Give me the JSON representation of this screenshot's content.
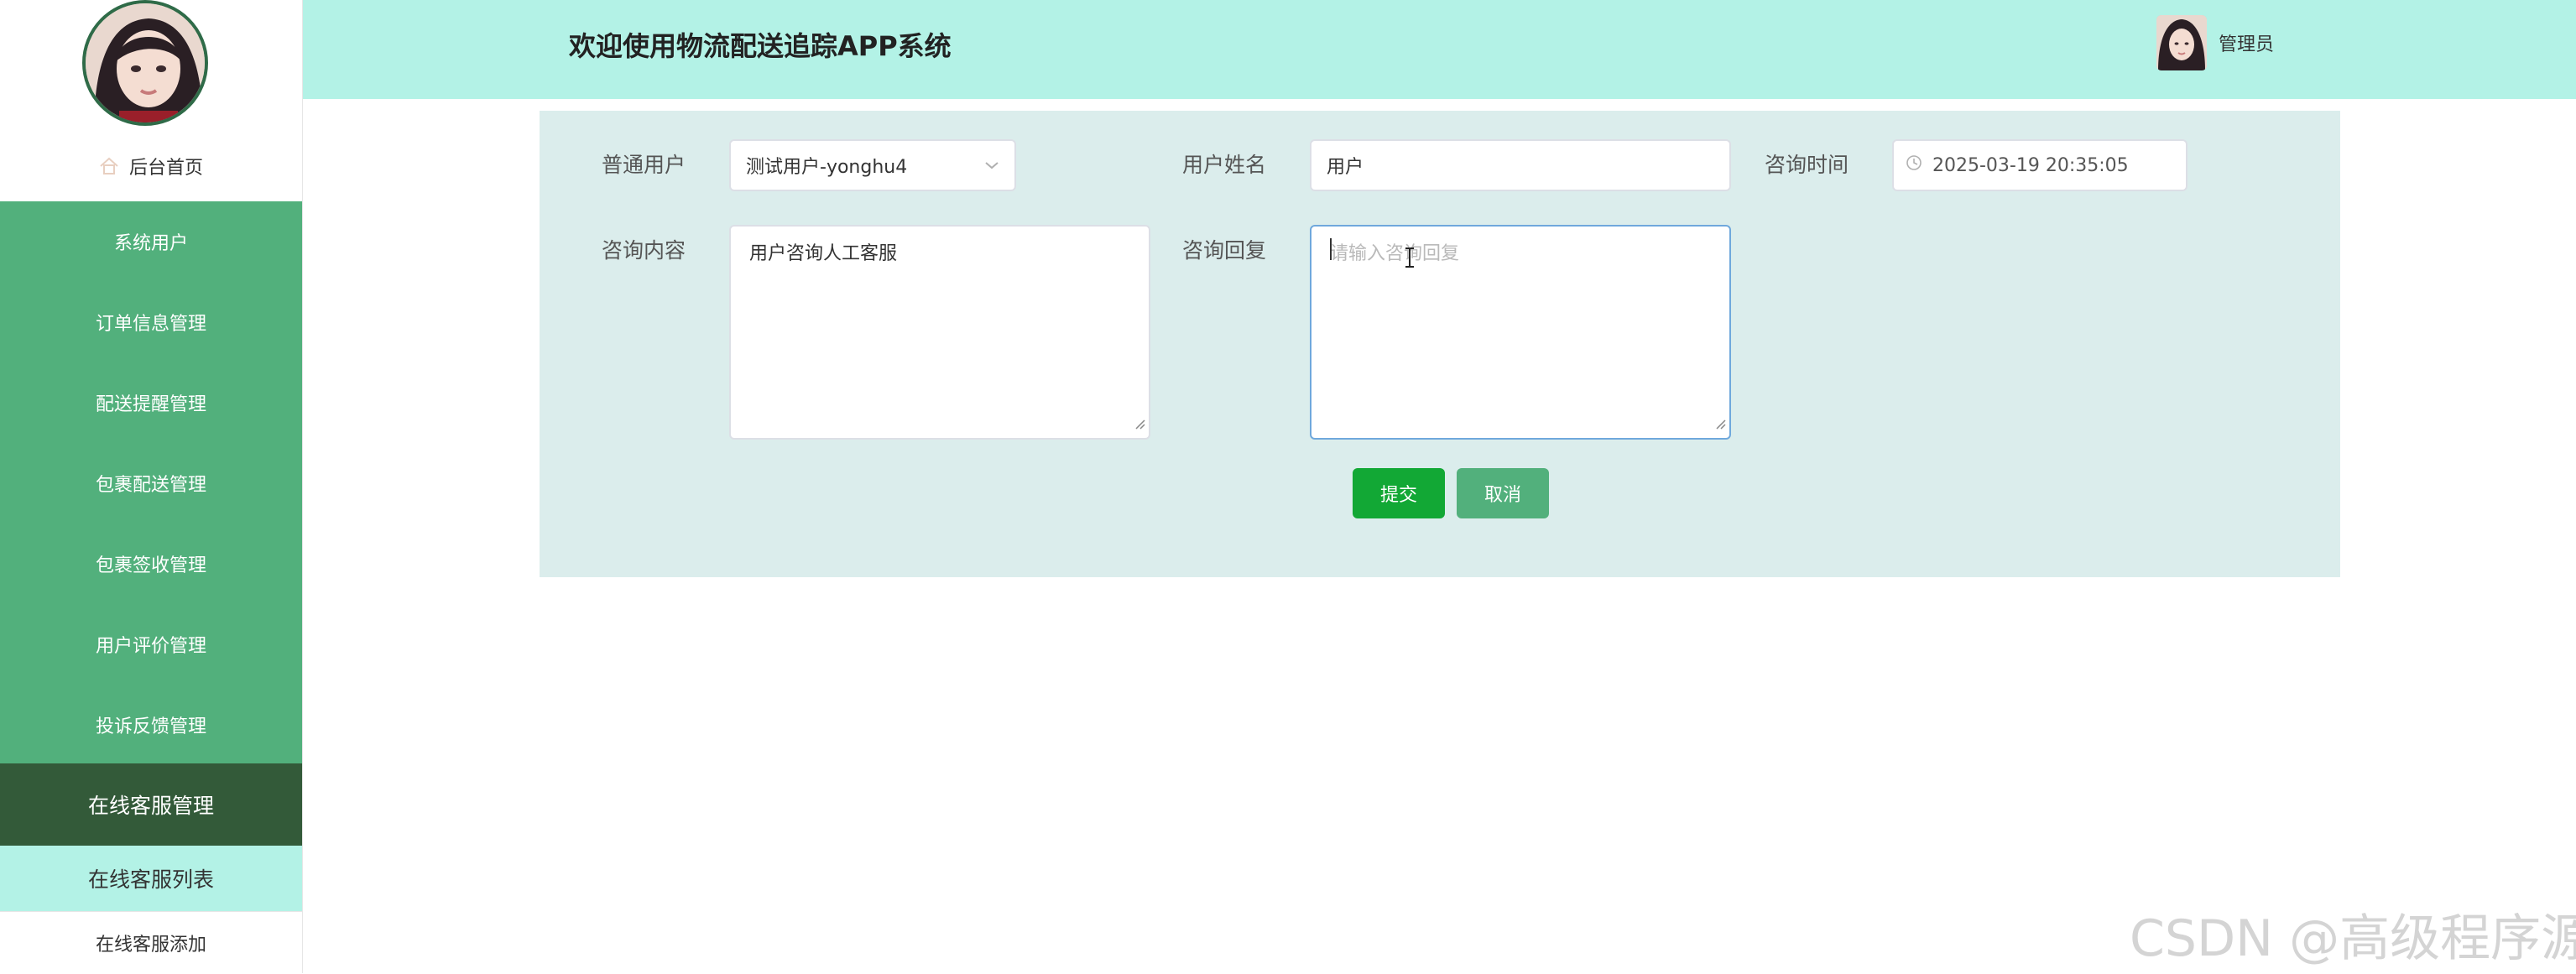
{
  "header": {
    "title": "欢迎使用物流配送追踪APP系统",
    "user_name": "管理员"
  },
  "sidebar": {
    "home_label": "后台首页",
    "menu": [
      {
        "label": "系统用户"
      },
      {
        "label": "订单信息管理"
      },
      {
        "label": "配送提醒管理"
      },
      {
        "label": "包裹配送管理"
      },
      {
        "label": "包裹签收管理"
      },
      {
        "label": "用户评价管理"
      },
      {
        "label": "投诉反馈管理"
      }
    ],
    "active_menu": {
      "label": "在线客服管理"
    },
    "submenu": [
      {
        "label": "在线客服列表"
      },
      {
        "label": "在线客服添加"
      }
    ]
  },
  "form": {
    "user_label": "普通用户",
    "user_value": "测试用户-yonghu4",
    "name_label": "用户姓名",
    "name_value": "用户",
    "time_label": "咨询时间",
    "time_value": "2025-03-19 20:35:05",
    "content_label": "咨询内容",
    "content_value": "用户咨询人工客服",
    "reply_label": "咨询回复",
    "reply_placeholder": "请输入咨询回复",
    "submit_label": "提交",
    "cancel_label": "取消"
  },
  "watermark": "CSDN @高级程序源",
  "colors": {
    "header_bg": "#b3f2e6",
    "menu_bg": "#52b07c",
    "menu_active_bg": "#335a39",
    "panel_bg": "#dbedec",
    "submit_bg": "#12a835",
    "cancel_bg": "#52b07c"
  },
  "icons": {
    "home": "home-icon",
    "select": "chevron-down-icon",
    "time": "clock-icon"
  }
}
